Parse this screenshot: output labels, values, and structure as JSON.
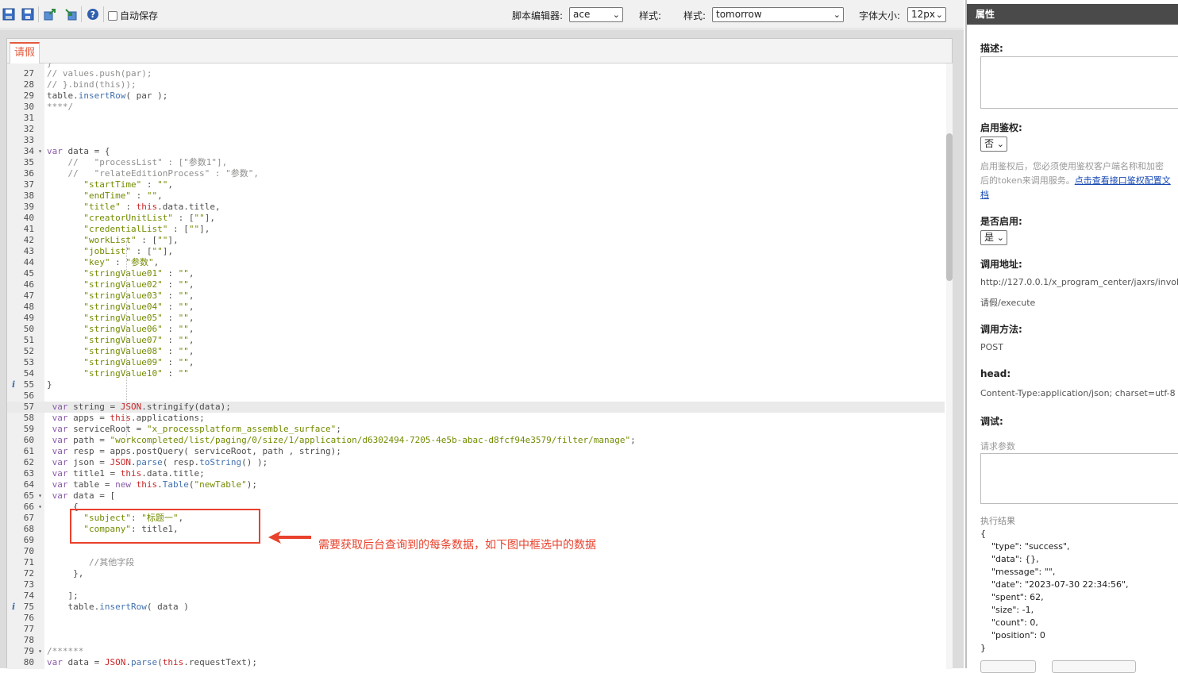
{
  "toolbar": {
    "autosave_label": "自动保存",
    "editor_label": "脚本编辑器:",
    "editor_value": "ace",
    "style_label_1": "样式:",
    "style_label_2": "样式:",
    "theme_value": "tomorrow",
    "fontsize_label": "字体大小:",
    "fontsize_value": "12px",
    "icons": [
      "save-icon",
      "save-as-icon",
      "export-icon",
      "import-icon",
      "help-icon"
    ]
  },
  "editor": {
    "tab_label": "请假",
    "code_lines": [
      {
        "n": "27",
        "t": "// values.push(par);"
      },
      {
        "n": "28",
        "t": "// }.bind(this));"
      },
      {
        "n": "29",
        "t": "table.insertRow( par );"
      },
      {
        "n": "30",
        "t": "****/"
      },
      {
        "n": "31",
        "t": ""
      },
      {
        "n": "32",
        "t": ""
      },
      {
        "n": "33",
        "t": ""
      },
      {
        "n": "34",
        "t": "var data = {"
      },
      {
        "n": "35",
        "t": "    //   \"processList\" : [\"参数1\"],"
      },
      {
        "n": "36",
        "t": "    //   \"relateEditionProcess\" : \"参数\","
      },
      {
        "n": "37",
        "t": "       \"startTime\" : \"\","
      },
      {
        "n": "38",
        "t": "       \"endTime\" : \"\","
      },
      {
        "n": "39",
        "t": "       \"title\" : this.data.title,"
      },
      {
        "n": "40",
        "t": "       \"creatorUnitList\" : [\"\"],"
      },
      {
        "n": "41",
        "t": "       \"credentialList\" : [\"\"],"
      },
      {
        "n": "42",
        "t": "       \"workList\" : [\"\"],"
      },
      {
        "n": "43",
        "t": "       \"jobList\" : [\"\"],"
      },
      {
        "n": "44",
        "t": "       \"key\" : \"参数\","
      },
      {
        "n": "45",
        "t": "       \"stringValue01\" : \"\","
      },
      {
        "n": "46",
        "t": "       \"stringValue02\" : \"\","
      },
      {
        "n": "47",
        "t": "       \"stringValue03\" : \"\","
      },
      {
        "n": "48",
        "t": "       \"stringValue04\" : \"\","
      },
      {
        "n": "49",
        "t": "       \"stringValue05\" : \"\","
      },
      {
        "n": "50",
        "t": "       \"stringValue06\" : \"\","
      },
      {
        "n": "51",
        "t": "       \"stringValue07\" : \"\","
      },
      {
        "n": "52",
        "t": "       \"stringValue08\" : \"\","
      },
      {
        "n": "53",
        "t": "       \"stringValue09\" : \"\","
      },
      {
        "n": "54",
        "t": "       \"stringValue10\" : \"\""
      },
      {
        "n": "55",
        "t": "}"
      },
      {
        "n": "56",
        "t": ""
      },
      {
        "n": "57",
        "t": " var string = JSON.stringify(data);"
      },
      {
        "n": "58",
        "t": " var apps = this.applications;"
      },
      {
        "n": "59",
        "t": " var serviceRoot = \"x_processplatform_assemble_surface\";"
      },
      {
        "n": "60",
        "t": " var path = \"workcompleted/list/paging/0/size/1/application/d6302494-7205-4e5b-abac-d8fcf94e3579/filter/manage\";"
      },
      {
        "n": "61",
        "t": " var resp = apps.postQuery( serviceRoot, path , string);"
      },
      {
        "n": "62",
        "t": " var json = JSON.parse( resp.toString() );"
      },
      {
        "n": "63",
        "t": " var title1 = this.data.title;"
      },
      {
        "n": "64",
        "t": " var table = new this.Table(\"newTable\");"
      },
      {
        "n": "65",
        "t": " var data = ["
      },
      {
        "n": "66",
        "t": "     {"
      },
      {
        "n": "67",
        "t": "       \"subject\": \"标题一\","
      },
      {
        "n": "68",
        "t": "       \"company\": title1,"
      },
      {
        "n": "69",
        "t": ""
      },
      {
        "n": "70",
        "t": ""
      },
      {
        "n": "71",
        "t": "        //其他字段"
      },
      {
        "n": "72",
        "t": "     },"
      },
      {
        "n": "73",
        "t": ""
      },
      {
        "n": "74",
        "t": "    ];"
      },
      {
        "n": "75",
        "t": "    table.insertRow( data )"
      },
      {
        "n": "76",
        "t": ""
      },
      {
        "n": "77",
        "t": ""
      },
      {
        "n": "78",
        "t": ""
      },
      {
        "n": "79",
        "t": "/******"
      },
      {
        "n": "80",
        "t": "var data = JSON.parse(this.requestText);"
      }
    ],
    "first_partial_line": "}",
    "annotation": "需要获取后台查询到的每条数据，如下图中框选中的数据"
  },
  "properties": {
    "header": "属性",
    "description_label": "描述:",
    "auth_label": "启用鉴权:",
    "auth_value": "否",
    "auth_hint_1": "启用鉴权后，您必须使用鉴权客户端名称和加密",
    "auth_hint_2": "后的token来调用服务。",
    "auth_hint_link_1": "点击查看接口鉴权配置文",
    "auth_hint_link_2": "档",
    "enabled_label": "是否启用:",
    "enabled_value": "是",
    "url_label": "调用地址:",
    "url_value_1": "http://127.0.0.1/x_program_center/jaxrs/invoke/",
    "url_value_2": "请假/execute",
    "method_label": "调用方法:",
    "method_value": "POST",
    "head_label": "head:",
    "head_value": "Content-Type:application/json; charset=utf-8",
    "debug_label": "调试:",
    "request_params_placeholder": "请求参数",
    "result_label": "执行结果",
    "result_lines": [
      "{",
      "    \"type\": \"success\",",
      "    \"data\": {},",
      "    \"message\": \"\",",
      "    \"date\": \"2023-07-30 22:34:56\",",
      "    \"spent\": 62,",
      "    \"size\": -1,",
      "    \"count\": 0,",
      "    \"position\": 0",
      "}"
    ]
  }
}
